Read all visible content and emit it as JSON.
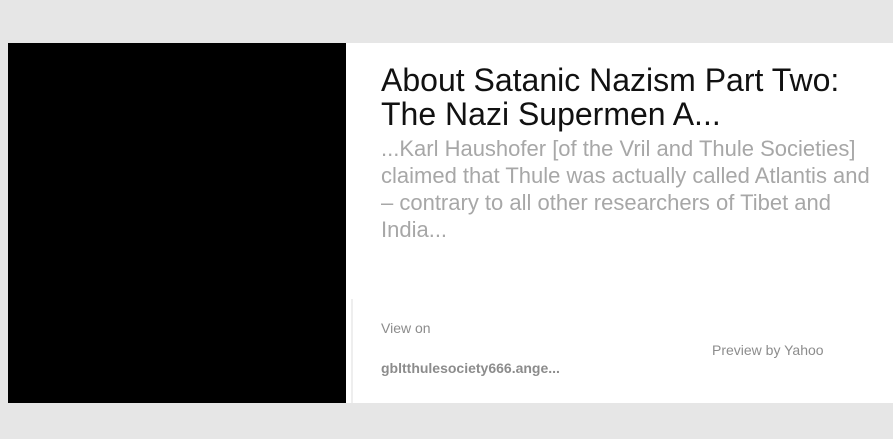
{
  "card": {
    "title": "About Satanic Nazism Part Two: The Nazi Supermen A...",
    "excerpt": "...Karl Haushofer [of the Vril and Thule Societies] claimed that Thule was actually called Atlantis and – contrary to all other researchers of Tibet and India...",
    "view_on_label": "View on",
    "source_domain": "gbltthulesociety666.ange...",
    "preview_by": "Preview by Yahoo"
  },
  "colors": {
    "page_background": "#e6e6e6",
    "card_background": "#ffffff",
    "thumbnail_background": "#000000",
    "title_text": "#111111",
    "excerpt_text": "#a7a7a7",
    "meta_text": "#8c8c8c"
  }
}
